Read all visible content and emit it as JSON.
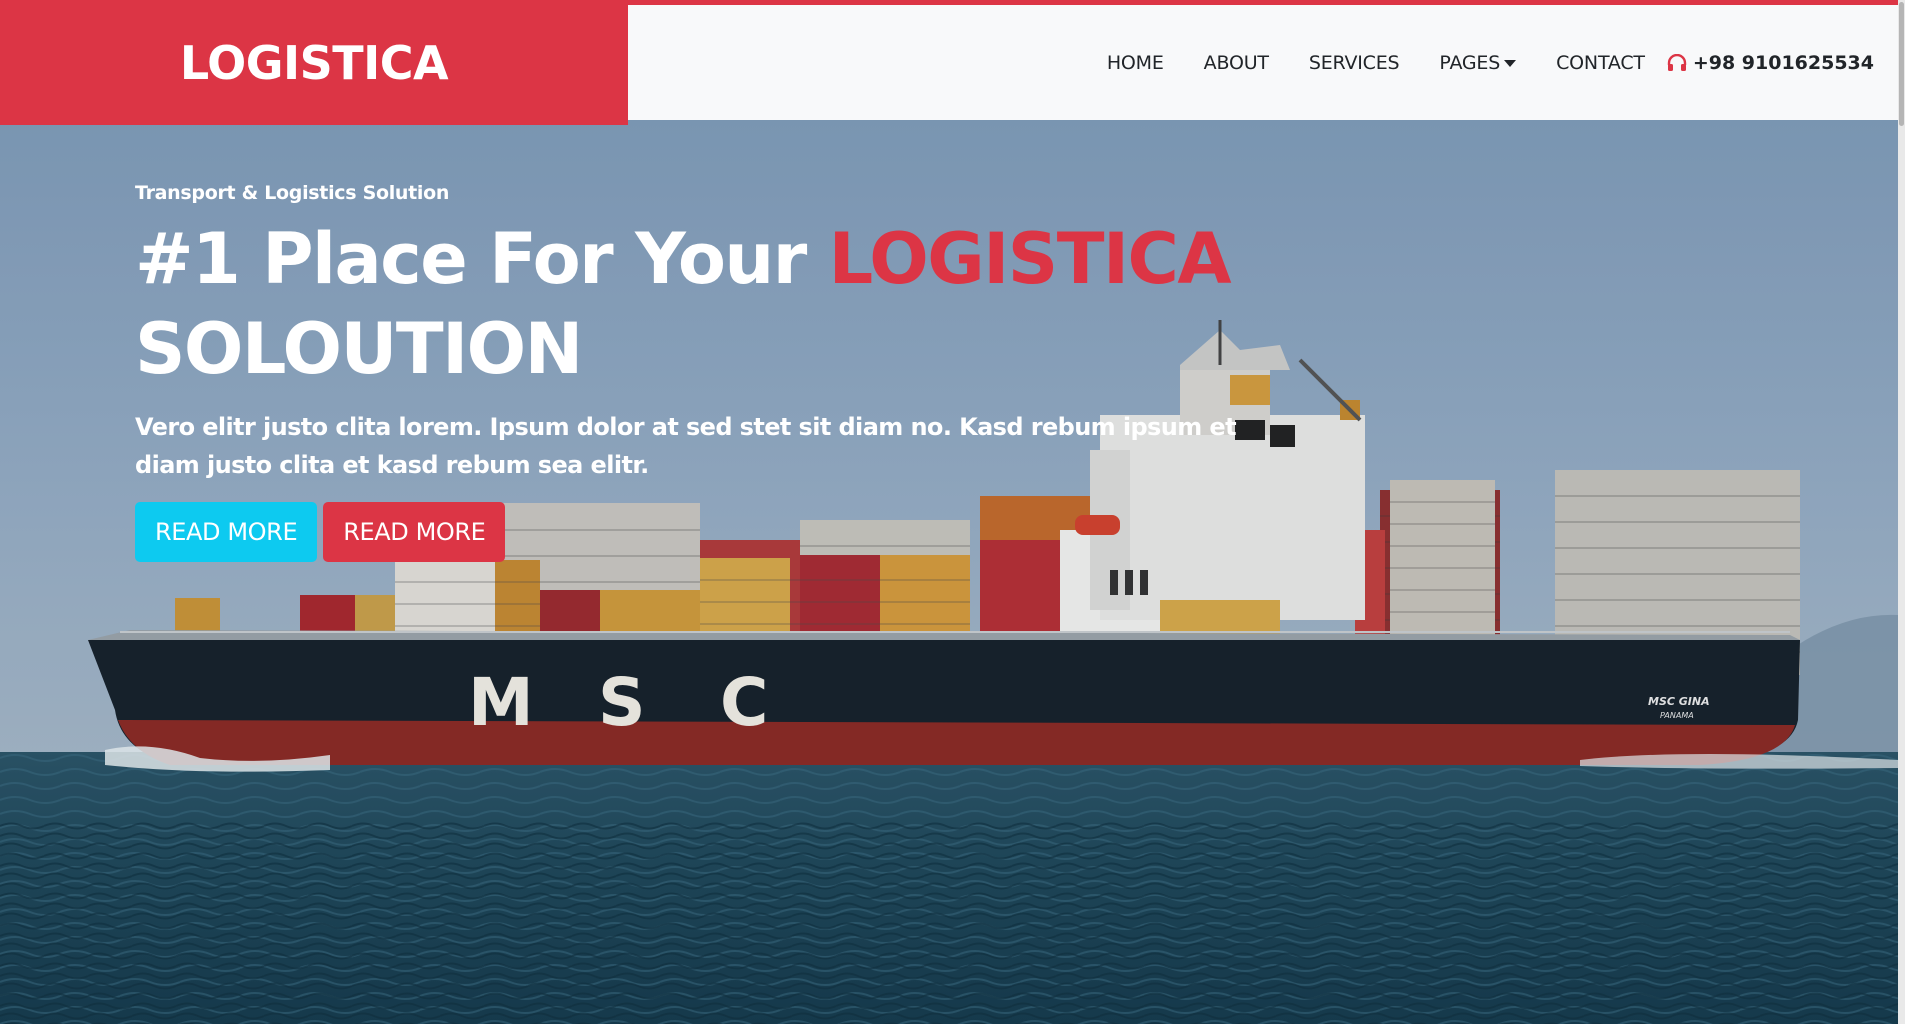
{
  "brand": {
    "name": "LOGISTICA"
  },
  "nav": {
    "items": [
      {
        "label": "HOME"
      },
      {
        "label": "ABOUT"
      },
      {
        "label": "SERVICES"
      },
      {
        "label": "PAGES"
      },
      {
        "label": "CONTACT"
      }
    ],
    "phone": "+98 9101625534",
    "phone_icon": "headphones-icon"
  },
  "hero": {
    "subtitle": "Transport & Logistics Solution",
    "title_part1": "#1 Place For Your ",
    "title_accent": "LOGISTICA",
    "title_part2": "SOLOUTION",
    "description": "Vero elitr justo clita lorem. Ipsum dolor at sed stet sit diam no. Kasd rebum ipsum et diam justo clita et kasd rebum sea elitr.",
    "buttons": [
      {
        "label": "READ MORE"
      },
      {
        "label": "READ MORE"
      }
    ],
    "ship_label": "MSC",
    "ship_name": "MSC GINA",
    "ship_port": "PANAMA"
  },
  "colors": {
    "primary": "#dc3545",
    "info": "#0dcaf0",
    "header_bg": "#f8f9fa"
  }
}
